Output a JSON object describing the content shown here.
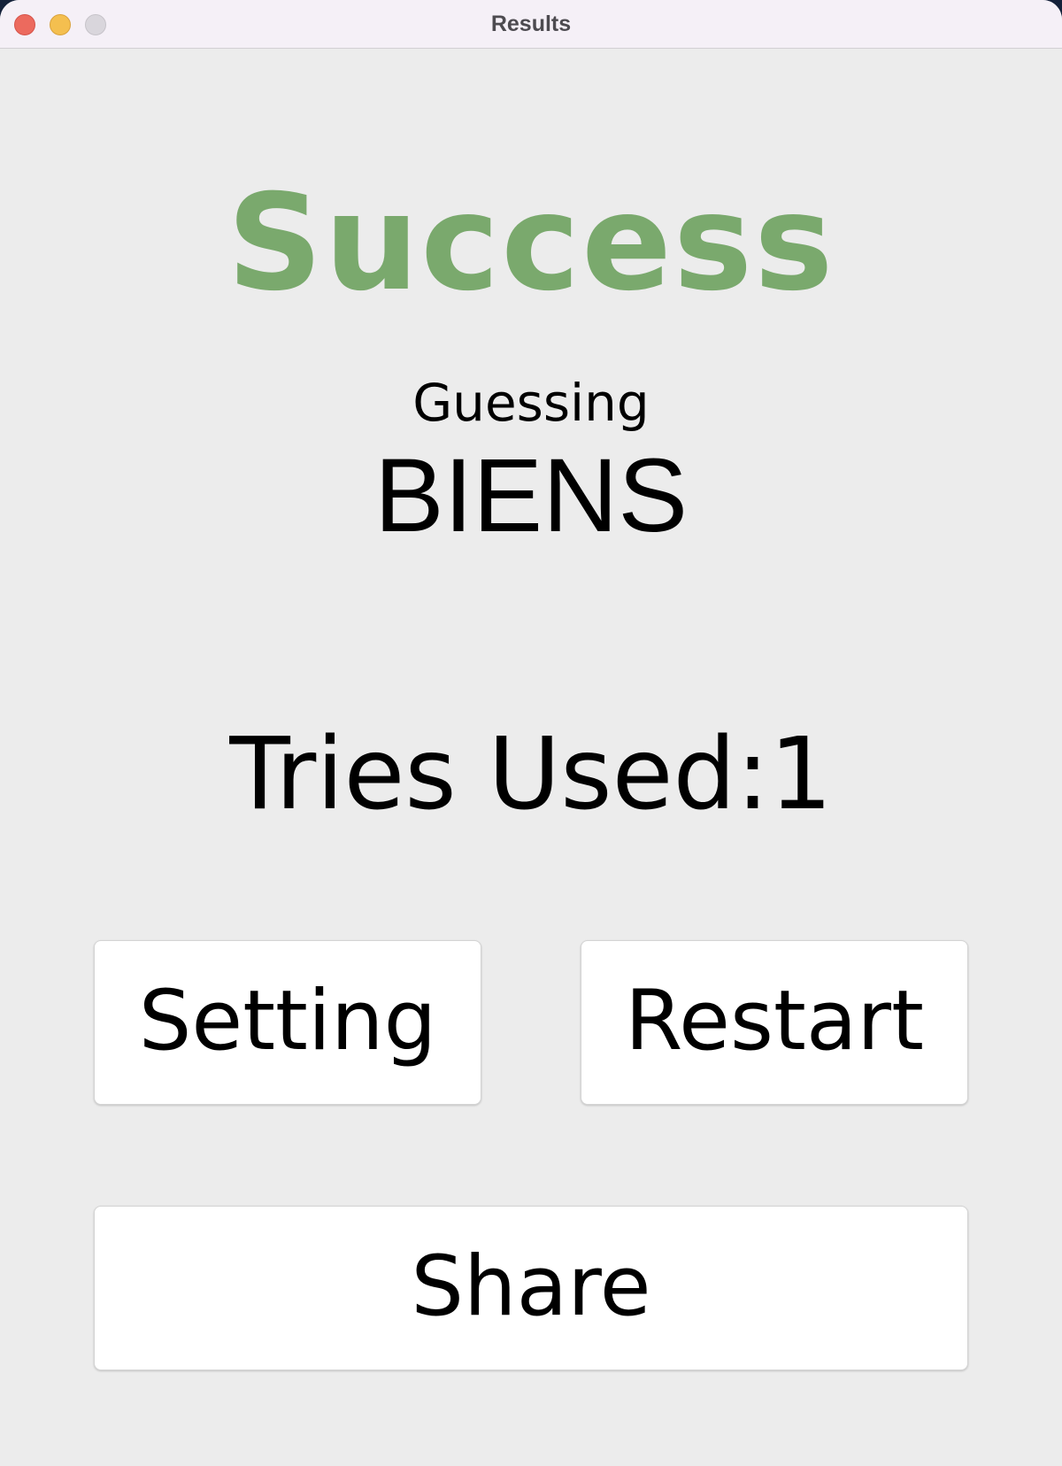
{
  "window": {
    "title": "Results"
  },
  "result": {
    "status": "Success",
    "status_color": "#7aa96d",
    "guessing_label": "Guessing",
    "word": "BIENS",
    "tries_text": "Tries Used:1"
  },
  "buttons": {
    "setting": "Setting",
    "restart": "Restart",
    "share": "Share"
  }
}
